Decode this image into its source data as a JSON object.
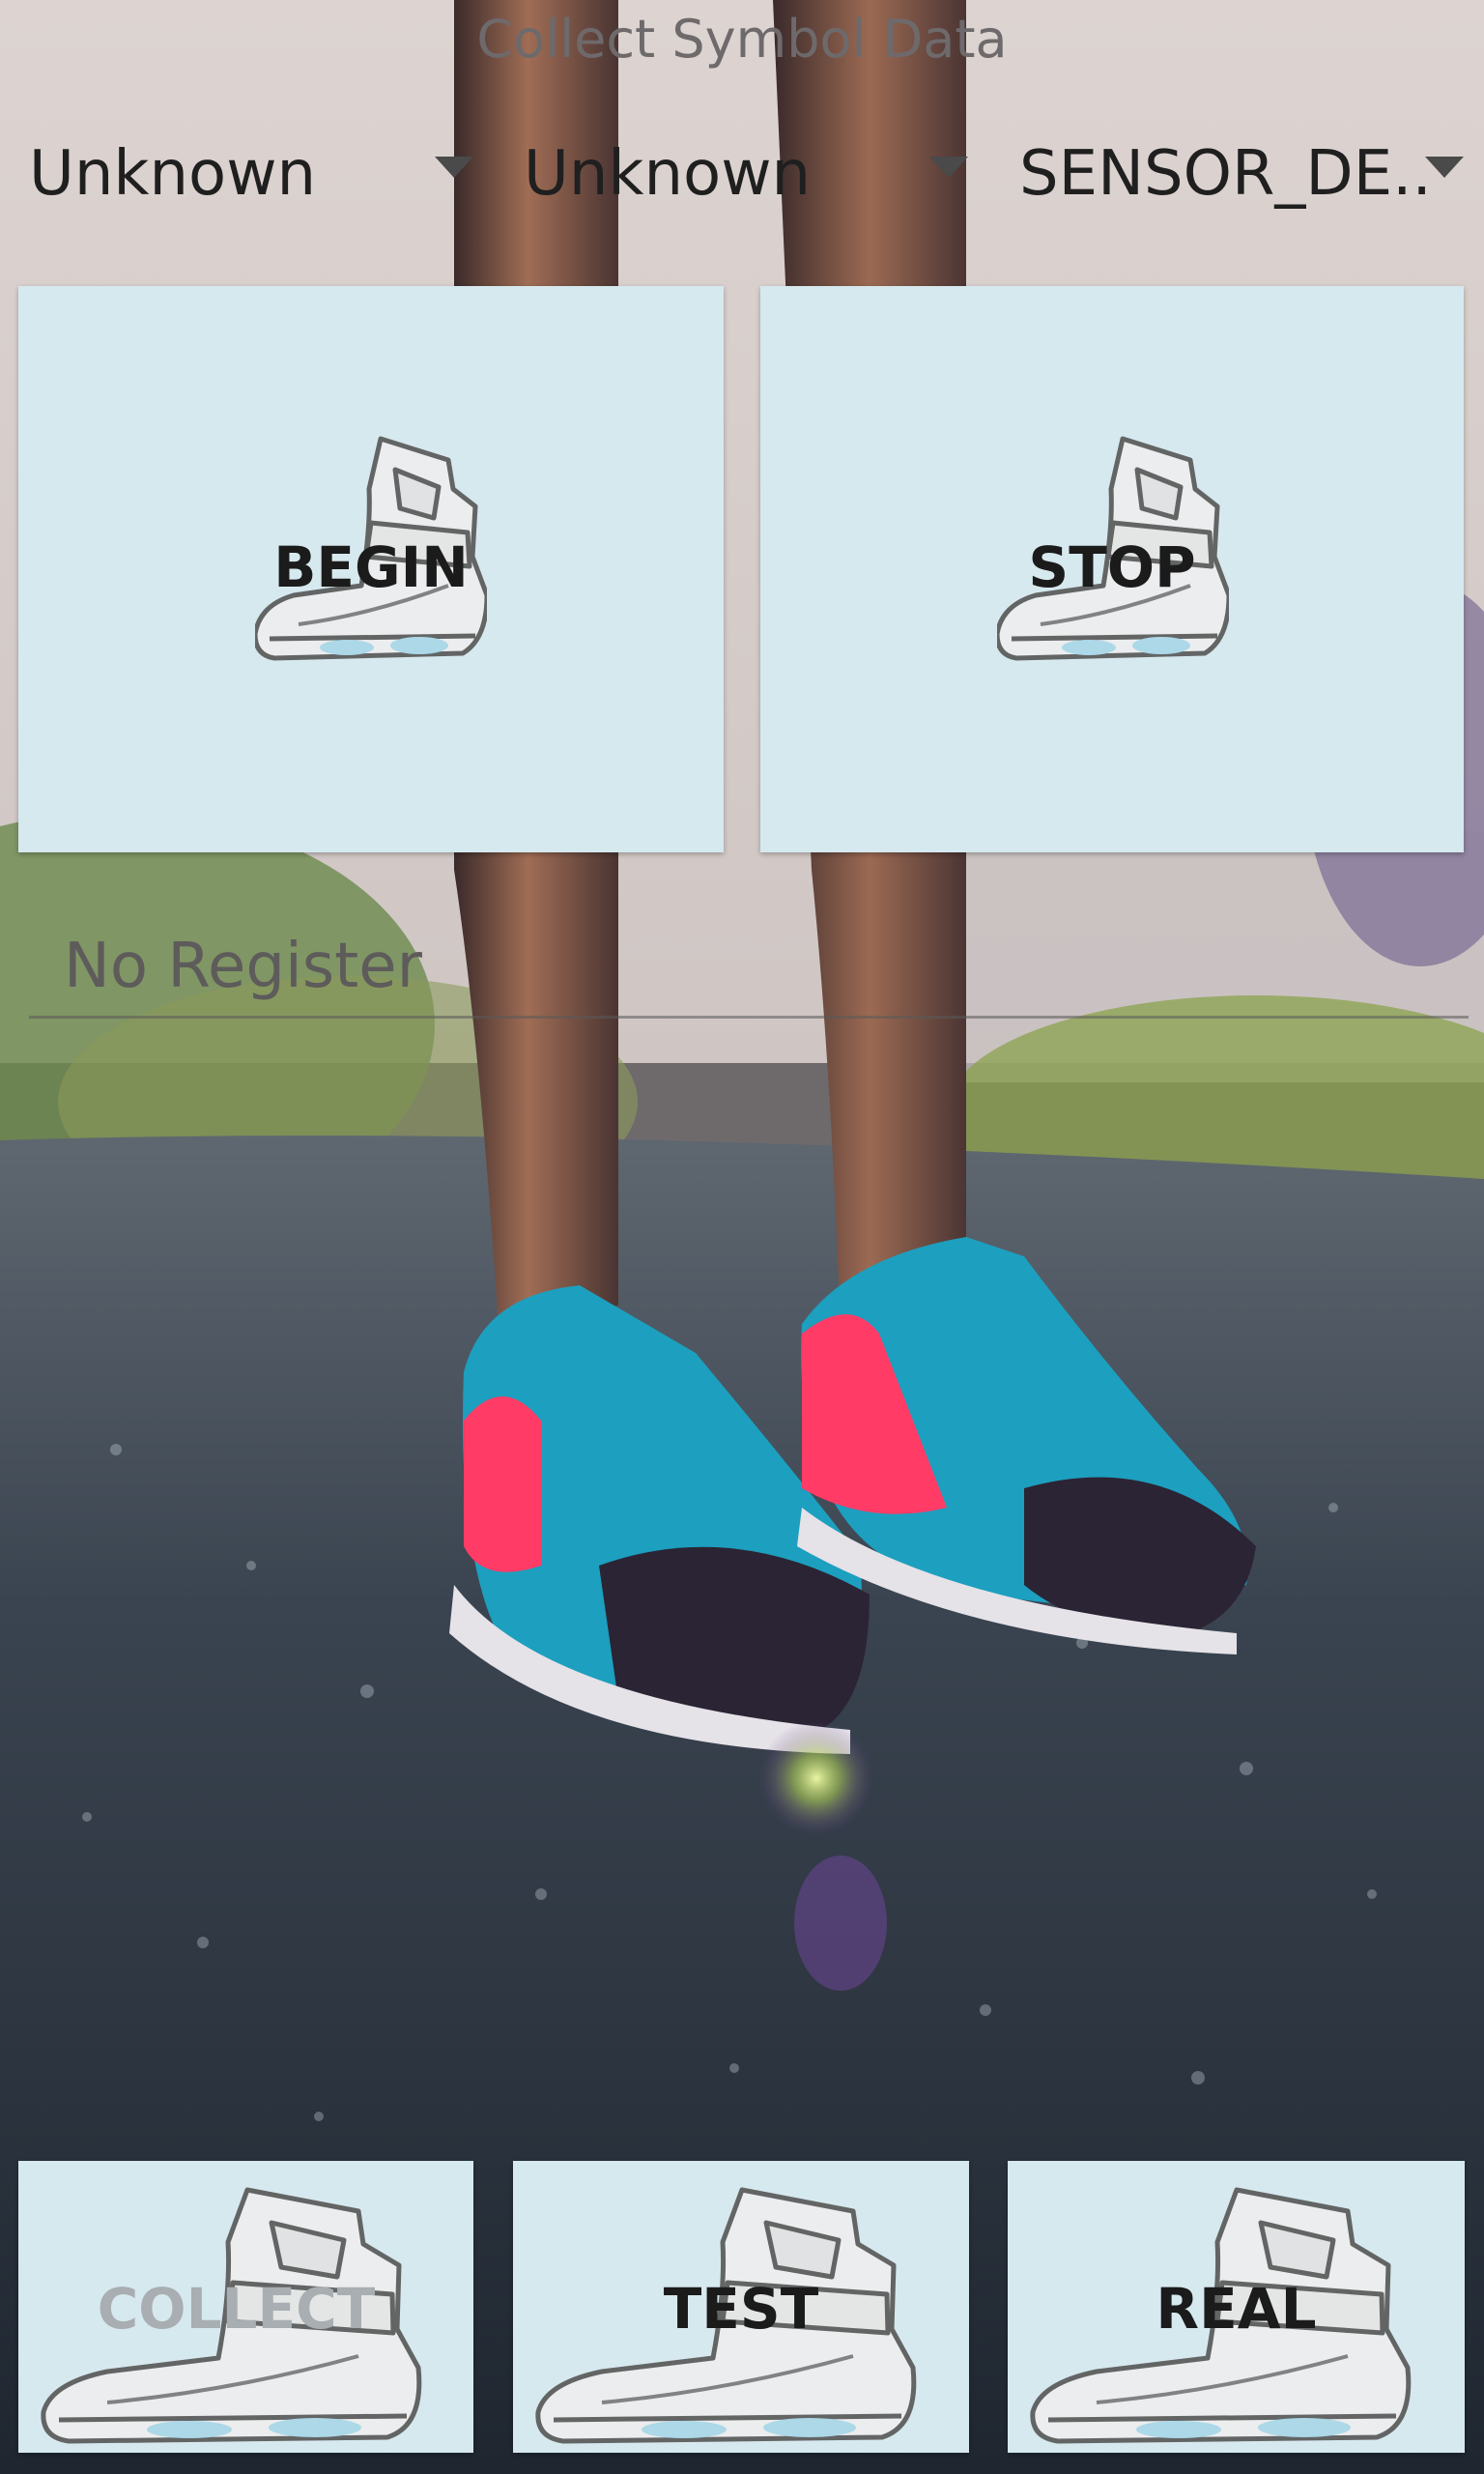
{
  "app": {
    "title": "Collect Symbol Data"
  },
  "spinners": [
    {
      "value": "Unknown"
    },
    {
      "value": "Unknown"
    },
    {
      "value": "SENSOR_DE.."
    }
  ],
  "buttons": {
    "begin": "BEGIN",
    "stop": "STOP",
    "collect": "COLLECT",
    "test": "TEST",
    "real": "REAL"
  },
  "register": {
    "placeholder": "No Register"
  },
  "icons": {
    "shoe": "shoe-icon",
    "dropdown": "dropdown-arrow-icon"
  },
  "colors": {
    "card_background": "#d6e9ef",
    "text_dark": "#1b1b1b",
    "text_disabled": "#a8aeb1"
  },
  "background": {
    "image": "photo-of-legs-wearing-sneakers"
  }
}
